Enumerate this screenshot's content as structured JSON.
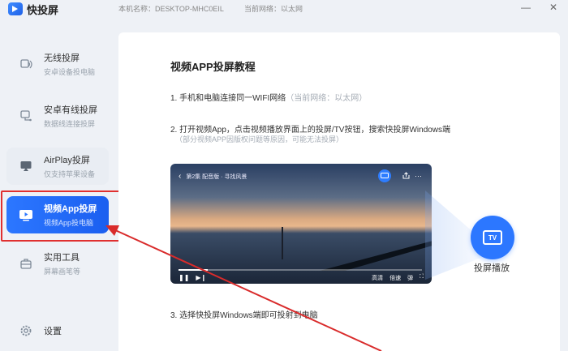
{
  "app": {
    "title": "快投屏",
    "device_info": "本机名称：DESKTOP-MHC0EIL",
    "network_info": "当前网络：以太网"
  },
  "window_controls": {
    "minimize": "—",
    "close": "✕"
  },
  "sidebar": {
    "items": [
      {
        "label": "无线投屏",
        "sub": "安卓设备投电脑",
        "icon": "wireless-cast-icon",
        "active": false
      },
      {
        "label": "安卓有线投屏",
        "sub": "数据线连接投屏",
        "icon": "usb-cable-icon",
        "active": false
      },
      {
        "label": "AirPlay投屏",
        "sub": "仅支持苹果设备",
        "icon": "airplay-icon",
        "active": false
      },
      {
        "label": "视频App投屏",
        "sub": "视频App投电脑",
        "icon": "video-app-icon",
        "active": true
      },
      {
        "label": "实用工具",
        "sub": "屏幕画笔等",
        "icon": "toolbox-icon",
        "active": false
      }
    ],
    "settings_label": "设置"
  },
  "tutorial": {
    "title": "视频APP投屏教程",
    "step1": "1. 手机和电脑连接同一WIFI网络",
    "step1_hint": "（当前网络：以太网）",
    "step2": "2. 打开视频App，点击视频播放界面上的投屏/TV按钮，搜索快投屏Windows端",
    "step2_note": "（部分视频APP因版权问题等原因，可能无法投屏）",
    "step3": "3. 选择快投屏Windows端即可投射到电脑"
  },
  "video_mock": {
    "back": "‹",
    "title": "第2集 配音版 · 寻找风景",
    "cast_icon": "tv-cast-icon",
    "share_icon": "share-icon",
    "more": "···",
    "progress": 0.12,
    "quality": "高清",
    "speed": "倍速",
    "danmaku": "弹",
    "fullscreen": "⛶"
  },
  "cast_target": {
    "tv_text": "TV",
    "label": "投屏播放"
  },
  "colors": {
    "accent": "#2c77ff",
    "highlight": "#e03030"
  }
}
